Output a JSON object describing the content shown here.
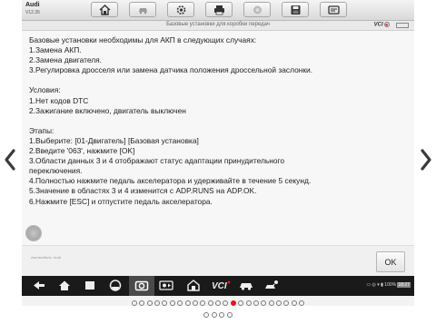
{
  "header": {
    "brand": "Audi",
    "version": "V12.35",
    "subtitle": "Базовые установки для коробки передач",
    "vci_label": "VCI",
    "toolbar_icons": [
      "home-icon",
      "car-icon",
      "gear-icon",
      "printer-icon",
      "help-icon",
      "save-icon",
      "data-icon"
    ]
  },
  "content": {
    "lines": [
      "Базовые установки необходимы для АКП в следующих случаях:",
      "1.Замена АКП.",
      "2.Замена двигателя.",
      "3.Регулировка дросселя или замена датчика положения дроссельной заслонки.",
      "",
      "Условия:",
      "1.Нет кодов DTC",
      "2.Зажигание включено, двигатель выключен",
      "",
      "Этапы:",
      "1.Выберите: [01-Двигатель] [Базовая установка]",
      "2.Введите '063', нажмите [OK]",
      "3.Области данных 3 и 4 отображают статус адаптации принудительного переключения.",
      "4.Полностью нажмите педаль акселератора и удерживайте в течение 5 секунд.",
      "5.Значение в областях 3 и 4 изменится с ADP.RUNS на ADP.OK.",
      "6.Нажмите [ESC] и отпустите педаль акселератора."
    ]
  },
  "footer": {
    "vehicle_path": "Автомобиль: Audi",
    "ok_label": "OK"
  },
  "navbar": {
    "icons": [
      "back-icon",
      "home-icon",
      "recent-apps-icon",
      "browser-icon",
      "camera-icon",
      "screen-record-icon",
      "home-garage-icon",
      "vci-icon",
      "car-icon",
      "mechanic-icon"
    ],
    "vci_text": "VCI",
    "battery_text": "100%",
    "clock": "18:27"
  },
  "pager": {
    "row1_count": 23,
    "row2_count": 4,
    "active_index": 13
  },
  "colors": {
    "accent": "#e8141c",
    "navbar": "#1a1a1a"
  }
}
